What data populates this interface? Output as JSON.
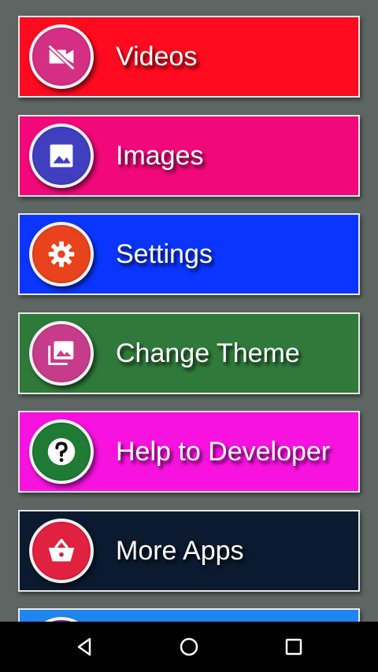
{
  "menu": {
    "items": [
      {
        "label": "Videos",
        "icon": "video-off-icon",
        "bg": "#ff0a1f",
        "icon_bg": "#d42f83"
      },
      {
        "label": "Images",
        "icon": "image-icon",
        "bg": "#f2087a",
        "icon_bg": "#3f3fbf"
      },
      {
        "label": "Settings",
        "icon": "gear-icon",
        "bg": "#0a35ff",
        "icon_bg": "#e8431c"
      },
      {
        "label": "Change Theme",
        "icon": "photo-library-icon",
        "bg": "#2f7a3a",
        "icon_bg": "#c73c8a"
      },
      {
        "label": "Help to Developer",
        "icon": "help-icon",
        "bg": "#f812e0",
        "icon_bg": "#1f7a34"
      },
      {
        "label": "More Apps",
        "icon": "basket-icon",
        "bg": "#0b1a2e",
        "icon_bg": "#e0213f"
      },
      {
        "label": "",
        "icon": "",
        "bg": "#1f86ef",
        "icon_bg": "#7a2f8a"
      }
    ]
  },
  "navbar": {
    "back_icon": "back-triangle-icon",
    "home_icon": "home-circle-icon",
    "recents_icon": "recents-square-icon",
    "bg": "#000000"
  }
}
